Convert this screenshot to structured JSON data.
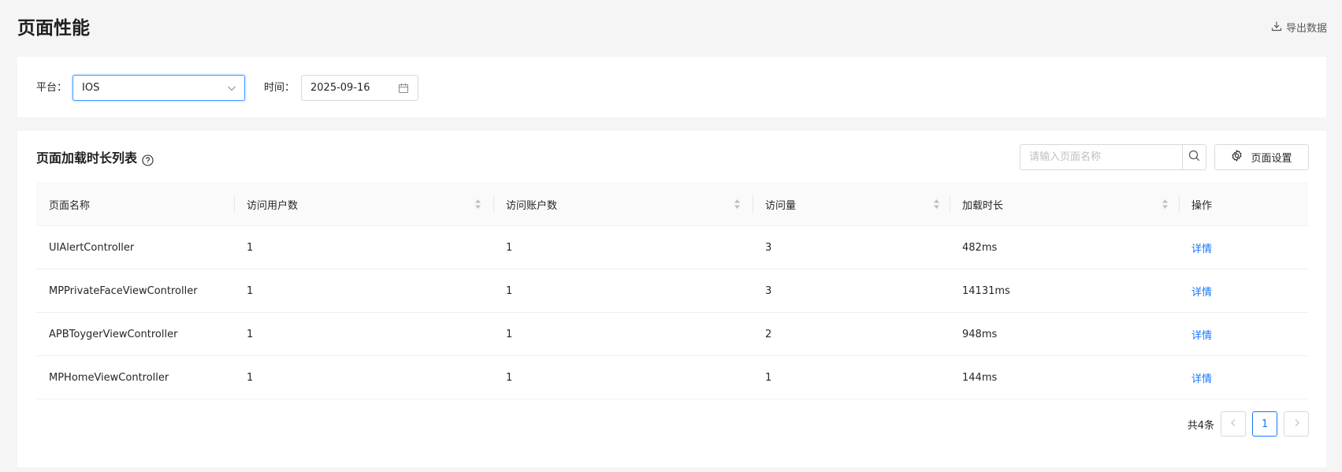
{
  "page": {
    "title": "页面性能",
    "export_label": "导出数据"
  },
  "filters": {
    "platform_label": "平台：",
    "platform_value": "IOS",
    "time_label": "时间：",
    "date_value": "2025-09-16"
  },
  "list": {
    "title": "页面加载时长列表",
    "search_placeholder": "请输入页面名称",
    "settings_label": "页面设置",
    "columns": [
      "页面名称",
      "访问用户数",
      "访问账户数",
      "访问量",
      "加载时长",
      "操作"
    ],
    "rows": [
      {
        "name": "UIAlertController",
        "users": "1",
        "accounts": "1",
        "visits": "3",
        "load_time": "482ms",
        "action": "详情"
      },
      {
        "name": "MPPrivateFaceViewController",
        "users": "1",
        "accounts": "1",
        "visits": "3",
        "load_time": "14131ms",
        "action": "详情"
      },
      {
        "name": "APBToygerViewController",
        "users": "1",
        "accounts": "1",
        "visits": "2",
        "load_time": "948ms",
        "action": "详情"
      },
      {
        "name": "MPHomeViewController",
        "users": "1",
        "accounts": "1",
        "visits": "1",
        "load_time": "144ms",
        "action": "详情"
      }
    ]
  },
  "pagination": {
    "total_label": "共4条",
    "current_page": "1"
  },
  "colors": {
    "accent": "#1677ff",
    "background": "#f5f5f5",
    "card": "#ffffff"
  },
  "icons": {
    "export": "download-icon",
    "select": "chevron-down-icon",
    "date": "calendar-icon",
    "help": "question-circle-icon",
    "search": "search-icon",
    "settings": "gear-icon",
    "sort": "sort-icon",
    "prev": "chevron-left-icon",
    "next": "chevron-right-icon"
  }
}
